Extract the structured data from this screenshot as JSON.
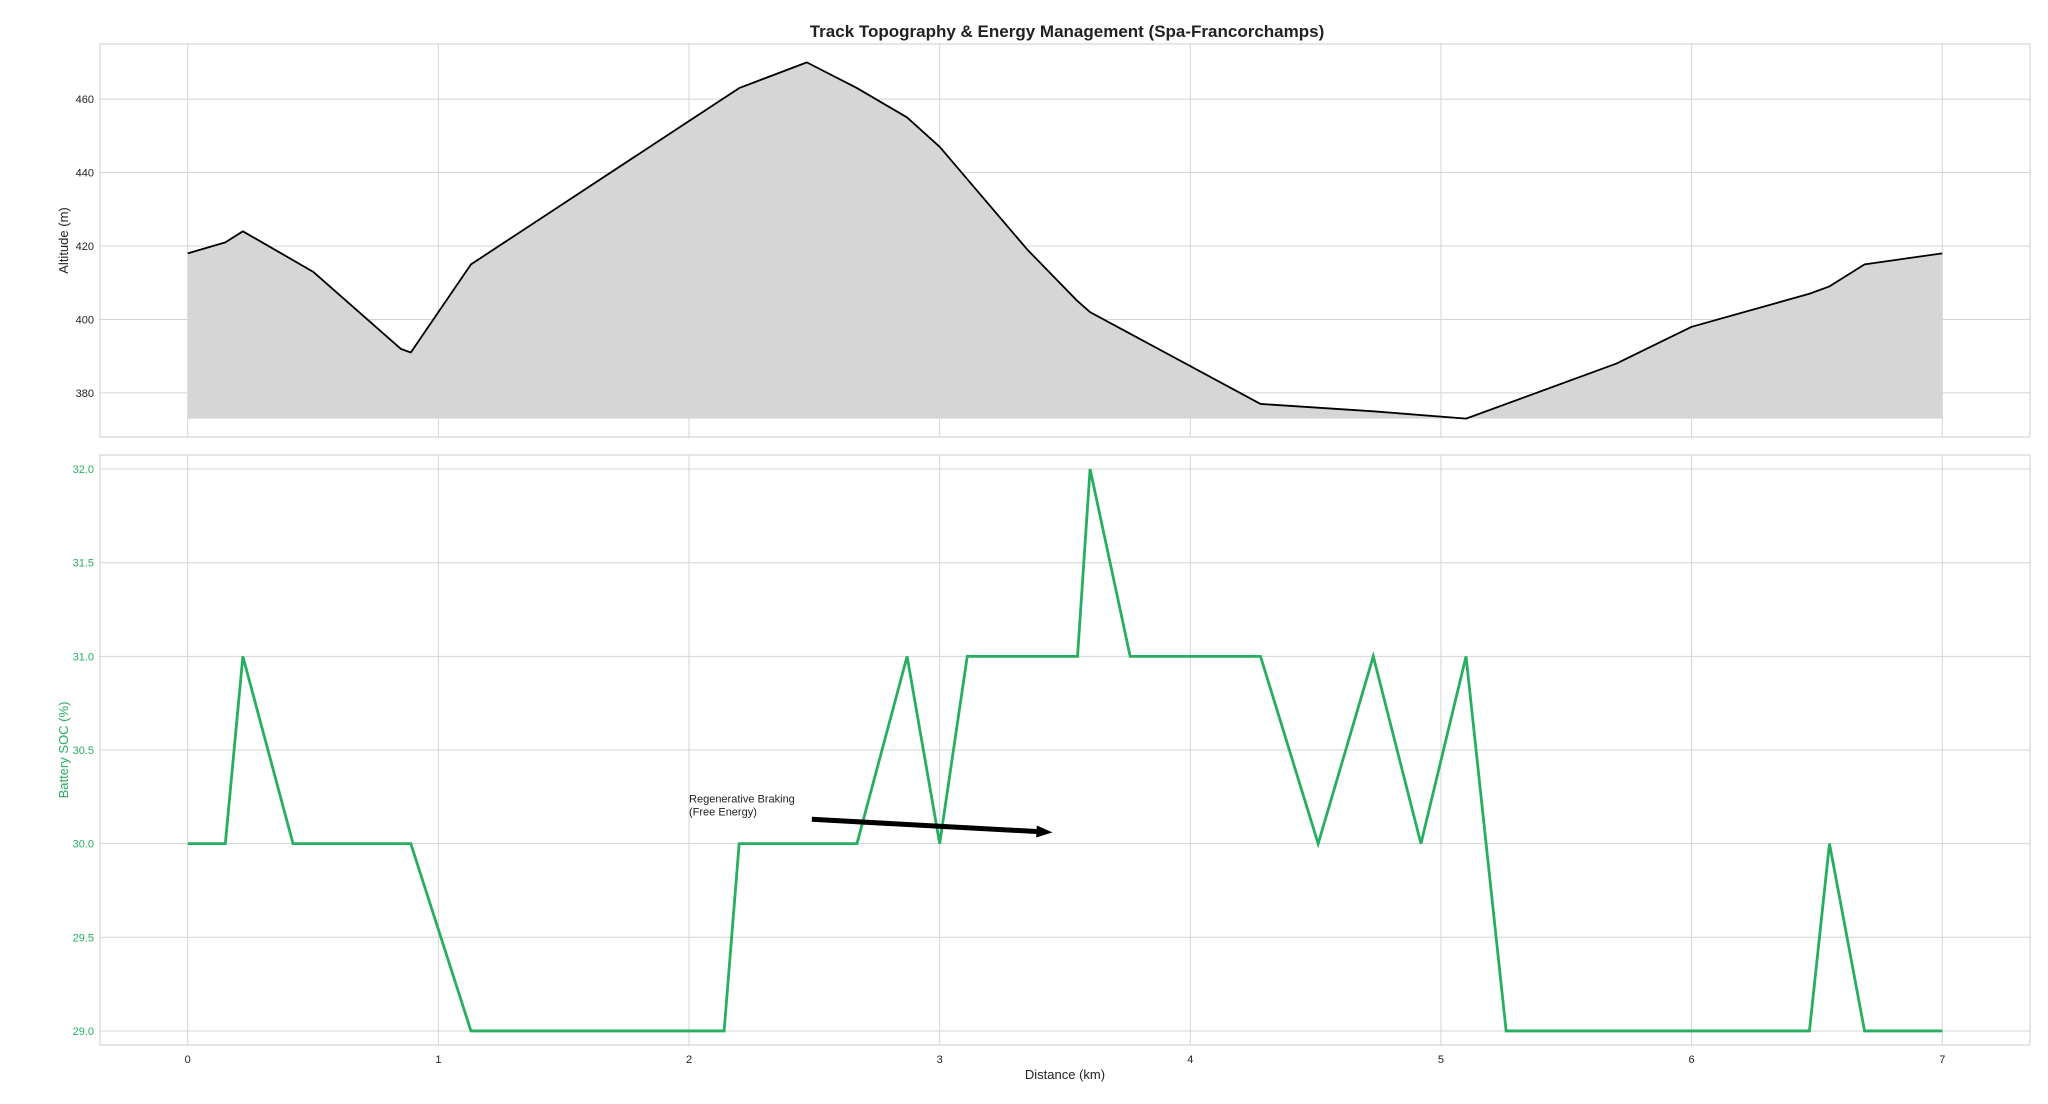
{
  "chart_data": [
    {
      "type": "area",
      "title": "Track Topography & Energy Management (Spa-Francorchamps)",
      "xlabel": "",
      "ylabel": "Altitude (m)",
      "xlim": [
        -0.35,
        7.35
      ],
      "ylim": [
        368,
        475
      ],
      "x_ticks": [
        0,
        1,
        2,
        3,
        4,
        5,
        6,
        7
      ],
      "y_ticks": [
        380,
        400,
        420,
        440,
        460
      ],
      "grid": true,
      "fill_base": 373,
      "colors": {
        "line": "#000000",
        "fill": "#d6d6d6"
      },
      "series": [
        {
          "x": [
            0,
            0.15,
            0.22,
            0.5,
            0.85,
            0.89,
            1.13,
            2.2,
            2.47,
            2.67,
            2.87,
            3.0,
            3.35,
            3.55,
            3.6,
            4.28,
            4.73,
            5.1,
            5.7,
            6.0,
            6.47,
            6.55,
            6.69,
            7.0
          ],
          "y": [
            418,
            421,
            424,
            413,
            392,
            391,
            415,
            463,
            470,
            463,
            455,
            447,
            419,
            405,
            402,
            377,
            375,
            373,
            388,
            398,
            407,
            409,
            415,
            418
          ]
        }
      ]
    },
    {
      "type": "line",
      "title": "",
      "xlabel": "Distance (km)",
      "ylabel": "Battery SOC (%)",
      "xlim": [
        -0.35,
        7.35
      ],
      "ylim": [
        28.925,
        32.075
      ],
      "x_ticks": [
        0,
        1,
        2,
        3,
        4,
        5,
        6,
        7
      ],
      "y_ticks": [
        29.0,
        29.5,
        30.0,
        30.5,
        31.0,
        31.5,
        32.0
      ],
      "y_tick_labels": [
        "29.0",
        "29.5",
        "30.0",
        "30.5",
        "31.0",
        "31.5",
        "32.0"
      ],
      "grid": true,
      "colors": {
        "line": "#27ae60",
        "ylabel": "#27ae60"
      },
      "series": [
        {
          "x": [
            0,
            0.15,
            0.22,
            0.42,
            0.89,
            1.13,
            2.14,
            2.2,
            2.67,
            2.87,
            3.0,
            3.11,
            3.55,
            3.6,
            3.76,
            4.28,
            4.51,
            4.73,
            4.92,
            5.1,
            5.26,
            6.47,
            6.55,
            6.69,
            7.0
          ],
          "y": [
            30,
            30,
            31,
            30,
            30,
            29,
            29,
            30,
            30,
            31,
            30,
            31,
            31,
            32,
            31,
            31,
            30,
            31,
            30,
            31,
            29,
            29,
            30,
            29,
            29
          ]
        }
      ],
      "annotation": {
        "text_lines": [
          "Regenerative Braking",
          "(Free Energy)"
        ],
        "text_at": [
          2.0,
          30.22
        ],
        "arrow_from": [
          2.49,
          30.13
        ],
        "arrow_to": [
          3.45,
          30.06
        ]
      }
    }
  ]
}
